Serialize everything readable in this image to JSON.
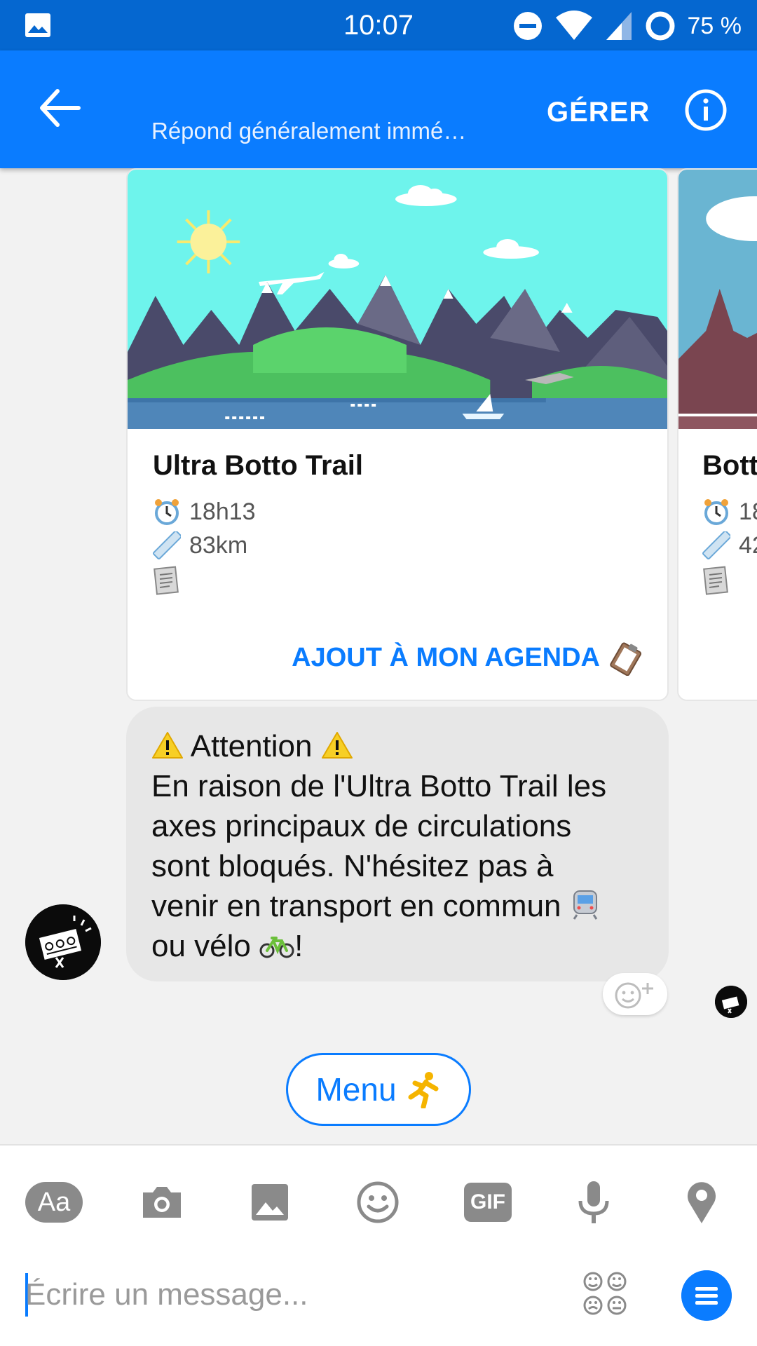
{
  "status_bar": {
    "time": "10:07",
    "battery": "75 %"
  },
  "header": {
    "subtitle": "Répond généralement immé…",
    "manage_label": "GÉRER"
  },
  "cards": [
    {
      "title": "Ultra Botto Trail",
      "time": "18h13",
      "distance": "83km",
      "action_label": "AJOUT À MON AGENDA"
    },
    {
      "title": "Bott",
      "time": "18",
      "distance": "42"
    }
  ],
  "message": {
    "heading": "Attention",
    "lines": [
      "En raison de l'Ultra Botto Trail les",
      "axes principaux de circulations",
      "sont bloqués. N'hésitez pas à",
      "venir en transport en commun",
      "ou vélo"
    ],
    "end": "!"
  },
  "quick_reply": {
    "label": "Menu"
  },
  "composer": {
    "placeholder": "Écrire un message...",
    "text_button": "Aa",
    "gif_button": "GIF"
  },
  "colors": {
    "brand": "#0a7cff",
    "status_bar": "#0567d0",
    "bubble": "#e7e7e7"
  }
}
